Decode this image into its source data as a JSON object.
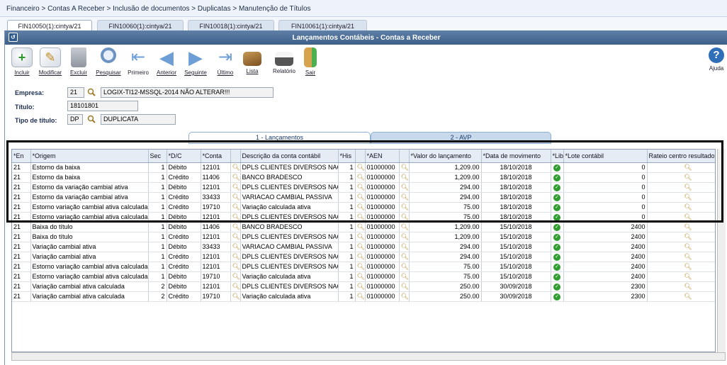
{
  "breadcrumb": "Financeiro > Contas A Receber > Inclusão de documentos > Duplicatas > Manutenção de Títulos",
  "tabs": [
    "FIN10050(1):cintya/21",
    "FIN10060(1):cintya/21",
    "FIN10018(1):cintya/21",
    "FIN10061(1):cintya/21"
  ],
  "window_title": "Lançamentos Contábeis - Contas a Receber",
  "toolbar": {
    "incluir": "Incluir",
    "modificar": "Modificar",
    "excluir": "Excluir",
    "pesquisar": "Pesquisar",
    "primeiro": "Primeiro",
    "anterior": "Anterior",
    "seguinte": "Seguinte",
    "ultimo": "Último",
    "lista": "Lista",
    "relatorio": "Relatório",
    "sair": "Sair",
    "ajuda": "Ajuda"
  },
  "form": {
    "empresa_label": "Empresa:",
    "empresa_code": "21",
    "empresa_name": "LOGIX-TI12-MSSQL-2014 NÃO ALTERAR!!!",
    "titulo_label": "Título:",
    "titulo_value": "18101801",
    "tipo_label": "Tipo de título:",
    "tipo_code": "DP",
    "tipo_name": "DUPLICATA"
  },
  "content_tabs": [
    "1 - Lançamentos",
    "2 - AVP"
  ],
  "columns": [
    "*En",
    "*Origem",
    "Sec",
    "*D/C",
    "*Conta",
    "",
    "Descrição da conta contábil",
    "*His",
    "",
    "*AEN",
    "",
    "*Valor do lançamento",
    "*Data de movimento",
    "*Lib",
    "*Lote contábil",
    "Rateio centro resultado"
  ],
  "rows": [
    [
      "21",
      "Estorno da baixa",
      "1",
      "Débito",
      "12101",
      "DPLS CLIENTES DIVERSOS NAC",
      "1",
      "01000000",
      "1,209.00",
      "18/10/2018",
      "0"
    ],
    [
      "21",
      "Estorno da baixa",
      "1",
      "Crédito",
      "11406",
      "BANCO BRADESCO",
      "1",
      "01000000",
      "1,209.00",
      "18/10/2018",
      "0"
    ],
    [
      "21",
      "Estorno da variação cambial ativa",
      "1",
      "Débito",
      "12101",
      "DPLS CLIENTES DIVERSOS NAC",
      "1",
      "01000000",
      "294.00",
      "18/10/2018",
      "0"
    ],
    [
      "21",
      "Estorno da variação cambial ativa",
      "1",
      "Crédito",
      "33433",
      "VARIACAO CAMBIAL PASSIVA",
      "1",
      "01000000",
      "294.00",
      "18/10/2018",
      "0"
    ],
    [
      "21",
      "Estorno variação cambial ativa calculada",
      "1",
      "Crédito",
      "19710",
      "Variação calculada ativa",
      "1",
      "01000000",
      "75.00",
      "18/10/2018",
      "0"
    ],
    [
      "21",
      "Estorno variação cambial ativa calculada",
      "1",
      "Débito",
      "12101",
      "DPLS CLIENTES DIVERSOS NAC",
      "1",
      "01000000",
      "75.00",
      "18/10/2018",
      "0"
    ],
    [
      "21",
      "Baixa do título",
      "1",
      "Débito",
      "11406",
      "BANCO BRADESCO",
      "1",
      "01000000",
      "1,209.00",
      "15/10/2018",
      "2400"
    ],
    [
      "21",
      "Baixa do título",
      "1",
      "Crédito",
      "12101",
      "DPLS CLIENTES DIVERSOS NAC",
      "1",
      "01000000",
      "1,209.00",
      "15/10/2018",
      "2400"
    ],
    [
      "21",
      "Variação cambial ativa",
      "1",
      "Débito",
      "33433",
      "VARIACAO CAMBIAL PASSIVA",
      "1",
      "01000000",
      "294.00",
      "15/10/2018",
      "2400"
    ],
    [
      "21",
      "Variação cambial ativa",
      "1",
      "Crédito",
      "12101",
      "DPLS CLIENTES DIVERSOS NAC",
      "1",
      "01000000",
      "294.00",
      "15/10/2018",
      "2400"
    ],
    [
      "21",
      "Estorno variação cambial ativa calculada",
      "1",
      "Crédito",
      "12101",
      "DPLS CLIENTES DIVERSOS NAC",
      "1",
      "01000000",
      "75.00",
      "15/10/2018",
      "2400"
    ],
    [
      "21",
      "Estorno variação cambial ativa calculada",
      "1",
      "Débito",
      "19710",
      "Variação calculada ativa",
      "1",
      "01000000",
      "75.00",
      "15/10/2018",
      "2400"
    ],
    [
      "21",
      "Variação cambial ativa calculada",
      "2",
      "Débito",
      "12101",
      "DPLS CLIENTES DIVERSOS NAC",
      "1",
      "01000000",
      "250.00",
      "30/09/2018",
      "2300"
    ],
    [
      "21",
      "Variação cambial ativa calculada",
      "2",
      "Crédito",
      "19710",
      "Variação calculada ativa",
      "1",
      "01000000",
      "250.00",
      "30/09/2018",
      "2300"
    ]
  ],
  "colors": {
    "highlight_border": "#000000",
    "check": "#2f9e2f",
    "titlebar": "#4a6c95"
  }
}
